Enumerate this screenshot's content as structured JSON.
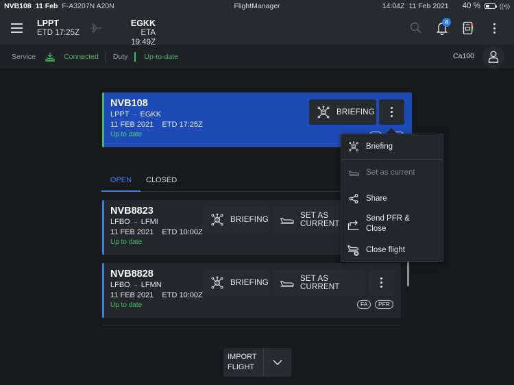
{
  "status_bar": {
    "flight_id": "NVB108",
    "date": "11 Feb",
    "aircraft": "F-A3207N A20N",
    "app_title": "FlightManager",
    "time": "14:04Z",
    "full_date": "11 Feb 2021",
    "battery": "40 %",
    "battery_level_pct": 40,
    "icons": [
      "battery-icon",
      "signal-icon"
    ]
  },
  "header": {
    "departure": {
      "code": "LPPT",
      "time": "ETD 17:25Z"
    },
    "arrival": {
      "code": "EGKK",
      "time": "ETA 19:49Z"
    },
    "notifications_count": "4",
    "icons": [
      "menu-icon",
      "plane-icon",
      "search-icon",
      "bell-icon",
      "logbook-icon",
      "more-vert-icon"
    ]
  },
  "service_bar": {
    "service_label": "Service",
    "service_status": "Connected",
    "duty_label": "Duty",
    "duty_status": "Up-to-date",
    "user": "Ca100",
    "colors": {
      "ok": "#3fbf5a"
    }
  },
  "current_flight": {
    "id": "NVB108",
    "origin": "LPPT",
    "destination": "EGKK",
    "arrow": "→",
    "date": "11 FEB 2021",
    "etd": "ETD 17:25Z",
    "status": "Up to date",
    "briefing_label": "BRIEFING",
    "color": "#1e4bb8"
  },
  "tabs": [
    {
      "label": "OPEN",
      "active": true
    },
    {
      "label": "CLOSED",
      "active": false
    }
  ],
  "flights": [
    {
      "id": "NVB8823",
      "origin": "LFBO",
      "destination": "LFMI",
      "date": "11 FEB 2021",
      "etd": "ETD 10:00Z",
      "status": "Up to date",
      "briefing_label": "BRIEFING",
      "set_current_label": "SET AS CURRENT",
      "chips": []
    },
    {
      "id": "NVB8828",
      "origin": "LFBO",
      "destination": "LFMN",
      "date": "11 FEB 2021",
      "etd": "ETD 10:00Z",
      "status": "Up to date",
      "briefing_label": "BRIEFING",
      "set_current_label": "SET AS CURRENT",
      "chips": [
        "FA",
        "PFR"
      ]
    }
  ],
  "menu": {
    "items": [
      {
        "label": "Briefing",
        "icon": "briefing-icon",
        "enabled": true
      },
      {
        "label": "Set as current",
        "icon": "plane-takeoff-icon",
        "enabled": false
      },
      {
        "label": "Share",
        "icon": "share-icon",
        "enabled": true
      },
      {
        "label": "Send PFR & Close",
        "line1": "Send PFR &",
        "line2": "Close",
        "icon": "send-icon",
        "enabled": true
      },
      {
        "label": "Close flight",
        "icon": "close-flight-icon",
        "enabled": true
      }
    ]
  },
  "import": {
    "line1": "IMPORT",
    "line2": "FLIGHT"
  }
}
